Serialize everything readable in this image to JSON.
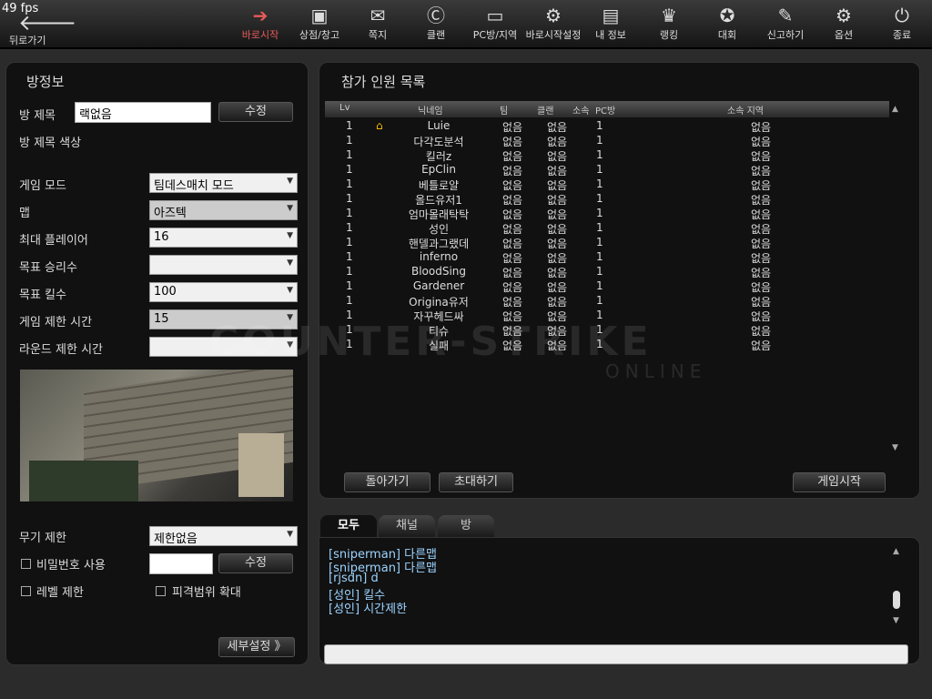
{
  "fps": "49 fps",
  "back": {
    "label": "뒤로가기",
    "icon": "back-arrow-icon"
  },
  "nav": [
    {
      "label": "바로시작",
      "icon": "quickstart-arrow-icon"
    },
    {
      "label": "상점/창고",
      "icon": "shop-icon"
    },
    {
      "label": "쪽지",
      "icon": "mail-icon"
    },
    {
      "label": "클랜",
      "icon": "clan-icon"
    },
    {
      "label": "PC방/지역",
      "icon": "pc-room-icon"
    },
    {
      "label": "바로시작설정",
      "icon": "quickstart-settings-icon"
    },
    {
      "label": "내 정보",
      "icon": "profile-card-icon"
    },
    {
      "label": "랭킹",
      "icon": "trophy-icon"
    },
    {
      "label": "대회",
      "icon": "medal-icon"
    },
    {
      "label": "신고하기",
      "icon": "report-icon"
    },
    {
      "label": "옵션",
      "icon": "gear-icon"
    },
    {
      "label": "종료",
      "icon": "power-icon"
    }
  ],
  "room": {
    "title": "방정보",
    "name_label": "방 제목",
    "name_value": "랙없음",
    "edit_label": "수정",
    "color_label": "방 제목 색상",
    "settings": [
      {
        "label": "게임 모드",
        "value": "팀데스매치 모드",
        "disabled": false
      },
      {
        "label": "맵",
        "value": "아즈텍",
        "disabled": true
      },
      {
        "label": "최대 플레이어",
        "value": "16",
        "disabled": false
      },
      {
        "label": "목표 승리수",
        "value": "",
        "disabled": false
      },
      {
        "label": "목표 킬수",
        "value": "100",
        "disabled": false
      },
      {
        "label": "게임 제한 시간",
        "value": "15",
        "disabled": true
      },
      {
        "label": "라운드 제한 시간",
        "value": "",
        "disabled": false
      }
    ],
    "weapon_label": "무기 제한",
    "weapon_value": "제한없음",
    "password_label": "비밀번호 사용",
    "password_edit": "수정",
    "level_label": "레벨 제한",
    "hitbox_label": "피격범위 확대",
    "detail_label": "세부설정 》"
  },
  "players": {
    "title": "참가 인원 목록",
    "headers": {
      "lv": "Lv",
      "nick": "닉네임",
      "team": "팀",
      "clan": "클랜",
      "rank": "소속",
      "pc": "PC방",
      "region": "소속 지역"
    },
    "rows": [
      {
        "lv": "1",
        "nick": "Luie",
        "team": "없음",
        "clan": "없음",
        "pc": "1",
        "region": "없음",
        "host": true
      },
      {
        "lv": "1",
        "nick": "다각도분석",
        "team": "없음",
        "clan": "없음",
        "pc": "1",
        "region": "없음"
      },
      {
        "lv": "1",
        "nick": "킬러z",
        "team": "없음",
        "clan": "없음",
        "pc": "1",
        "region": "없음"
      },
      {
        "lv": "1",
        "nick": "EpClin",
        "team": "없음",
        "clan": "없음",
        "pc": "1",
        "region": "없음"
      },
      {
        "lv": "1",
        "nick": "베틀로얄",
        "team": "없음",
        "clan": "없음",
        "pc": "1",
        "region": "없음"
      },
      {
        "lv": "1",
        "nick": "올드유저1",
        "team": "없음",
        "clan": "없음",
        "pc": "1",
        "region": "없음"
      },
      {
        "lv": "1",
        "nick": "엄마몰래탁탁",
        "team": "없음",
        "clan": "없음",
        "pc": "1",
        "region": "없음"
      },
      {
        "lv": "1",
        "nick": "성인",
        "team": "없음",
        "clan": "없음",
        "pc": "1",
        "region": "없음"
      },
      {
        "lv": "1",
        "nick": "핸델과그랬데",
        "team": "없음",
        "clan": "없음",
        "pc": "1",
        "region": "없음"
      },
      {
        "lv": "1",
        "nick": "inferno",
        "team": "없음",
        "clan": "없음",
        "pc": "1",
        "region": "없음"
      },
      {
        "lv": "1",
        "nick": "BloodSing",
        "team": "없음",
        "clan": "없음",
        "pc": "1",
        "region": "없음"
      },
      {
        "lv": "1",
        "nick": "Gardener",
        "team": "없음",
        "clan": "없음",
        "pc": "1",
        "region": "없음"
      },
      {
        "lv": "1",
        "nick": "Origina유저",
        "team": "없음",
        "clan": "없음",
        "pc": "1",
        "region": "없음"
      },
      {
        "lv": "1",
        "nick": "자꾸헤드싸",
        "team": "없음",
        "clan": "없음",
        "pc": "1",
        "region": "없음"
      },
      {
        "lv": "1",
        "nick": "티슈",
        "team": "없음",
        "clan": "없음",
        "pc": "1",
        "region": "없음"
      },
      {
        "lv": "1",
        "nick": "실패",
        "team": "없음",
        "clan": "없음",
        "pc": "1",
        "region": "없음"
      }
    ],
    "back_btn": "돌아가기",
    "invite_btn": "초대하기",
    "start_btn": "게임시작"
  },
  "watermark": {
    "main": "COUNTER-STRIKE",
    "sub": "ONLINE"
  },
  "chat": {
    "tabs": [
      "모두",
      "채널",
      "방"
    ],
    "lines": [
      "[sniperman] 다른맵",
      "[sniperman] 다른맵",
      "[rjsdn] d",
      "[성인] 킬수",
      "[성인] 시간제한"
    ]
  },
  "colors": {
    "active_nav": "#e85a5a",
    "chat_text": "#9bd3ff",
    "host_icon": "#f5b800"
  }
}
